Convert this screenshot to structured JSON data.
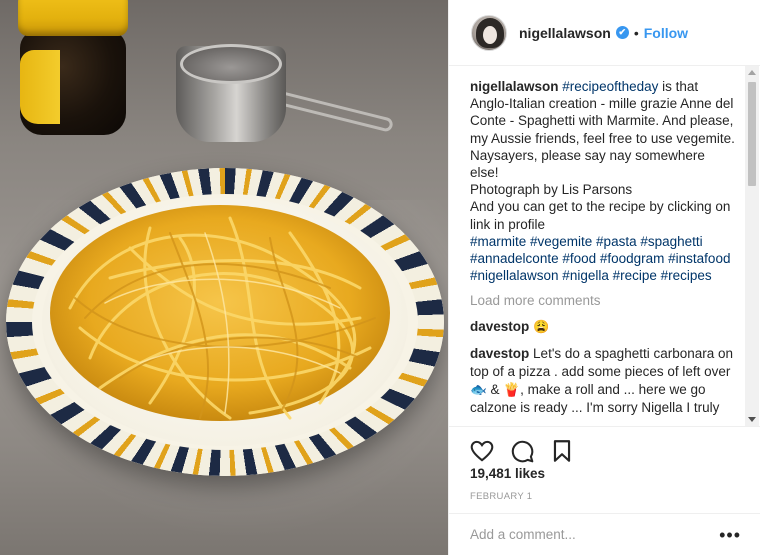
{
  "post": {
    "photo_alt": "spaghetti-with-marmite-photo"
  },
  "header": {
    "username": "nigellalawson",
    "verified_glyph": "✔",
    "separator": "•",
    "follow_label": "Follow"
  },
  "caption": {
    "username": "nigellalawson",
    "hashtag_first": "#recipeoftheday",
    "text_1": " is that Anglo-Italian creation - mille grazie Anne del Conte - Spaghetti with Marmite. And please, my Aussie friends, feel free to use vegemite. Naysayers, please say nay somewhere else!",
    "text_2": "Photograph by Lis Parsons",
    "text_3": "And you can get to the recipe by clicking on link in profile",
    "hashtags": "#marmite #vegemite #pasta #spaghetti #annadelconte #food #foodgram #instafood #nigellalawson #nigella #recipe #recipes"
  },
  "load_more_label": "Load more comments",
  "comments": [
    {
      "username": "davestop",
      "text": "😩"
    },
    {
      "username": "davestop",
      "text": "Let's do a spaghetti carbonara on top of a pizza . add some pieces of left over 🐟 & 🍟, make a roll and ... here we go calzone is ready ... I'm sorry Nigella I truly"
    }
  ],
  "likes": "19,481 likes",
  "date": "FEBRUARY 1",
  "add_comment": {
    "placeholder": "Add a comment...",
    "more_glyph": "•••"
  },
  "icons": {
    "like": "heart-icon",
    "comment": "comment-icon",
    "save": "bookmark-icon",
    "more": "more-options-icon"
  },
  "colors": {
    "link": "#3897f0",
    "hashtag": "#003569",
    "muted": "#999999",
    "text": "#262626"
  }
}
